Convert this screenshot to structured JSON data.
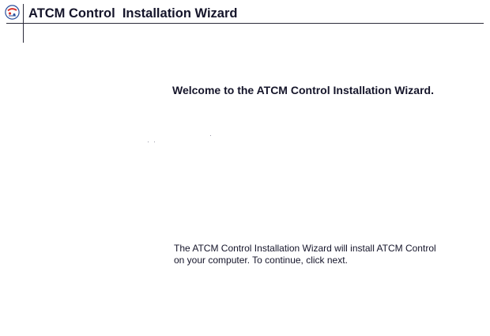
{
  "window": {
    "title": "ATCM Control  Installation Wizard",
    "logo_icon": "atcm-logo-icon"
  },
  "main": {
    "welcome_heading": "Welcome to the ATCM Control Installation Wizard.",
    "description_lines": [
      "The ATCM Control Installation Wizard will install ATCM Control",
      "on your computer. To continue, click next."
    ]
  },
  "colors": {
    "text": "#15152a",
    "rule": "#2b2b3a",
    "background": "#ffffff",
    "logo_red": "#d8332e",
    "logo_blue": "#2a4f9c"
  }
}
